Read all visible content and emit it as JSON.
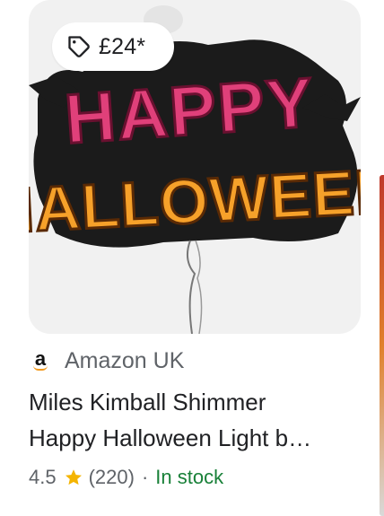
{
  "product": {
    "price": "£24*",
    "image_alt": "Happy Halloween light-up sign",
    "art_text_line1": "HAPPY",
    "art_text_line2": "HALLOWEEN",
    "store": {
      "name": "Amazon UK",
      "logo_letter": "a"
    },
    "title_line1": "Miles Kimball Shimmer",
    "title_line2": "Happy Halloween Light b…",
    "rating": "4.5",
    "review_count": "(220)",
    "separator": "·",
    "availability": "In stock"
  },
  "icons": {
    "price_tag": "tag-icon",
    "rating_star": "star-icon"
  },
  "colors": {
    "tile_bg": "#f1f1f1",
    "text_primary": "#202124",
    "text_secondary": "#5f6368",
    "in_stock": "#188038",
    "star": "#f4b400",
    "amazon_smile": "#f29a1f"
  }
}
